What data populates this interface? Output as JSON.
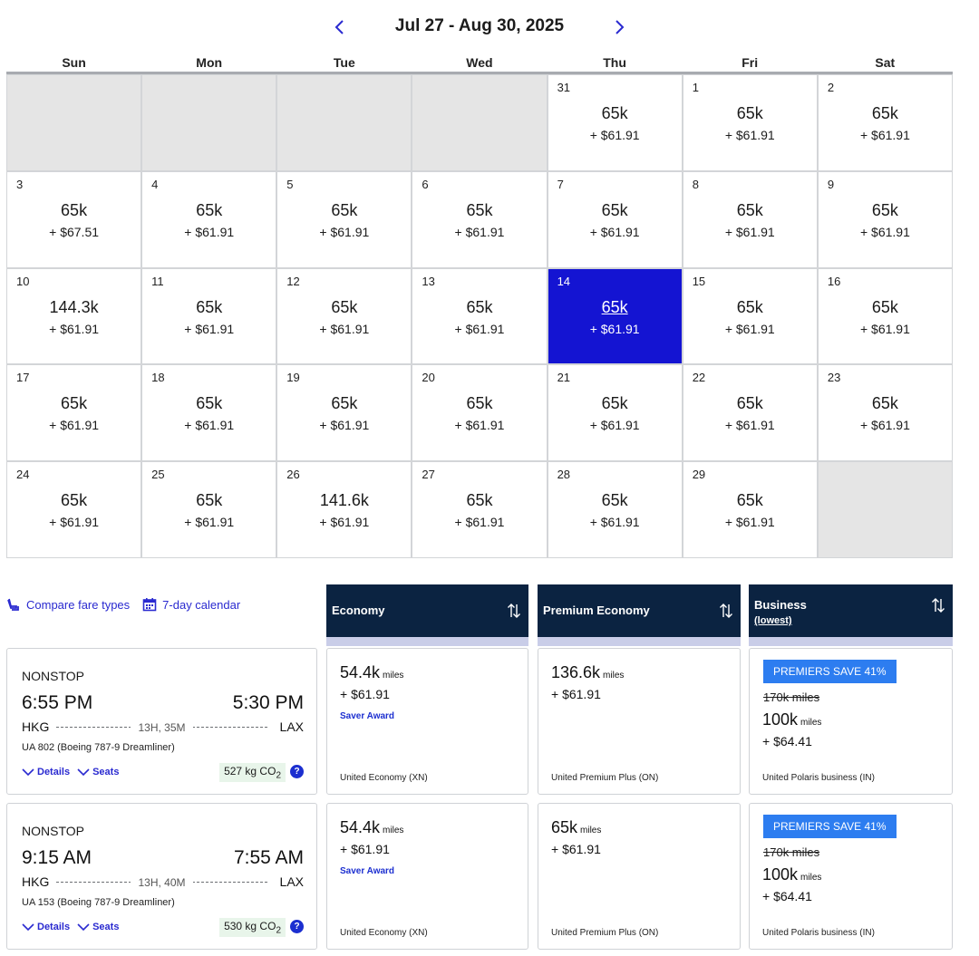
{
  "calendar": {
    "range": "Jul 27 - Aug 30, 2025",
    "weekdays": [
      "Sun",
      "Mon",
      "Tue",
      "Wed",
      "Thu",
      "Fri",
      "Sat"
    ],
    "days": [
      null,
      null,
      null,
      null,
      {
        "d": "31",
        "m": "65k",
        "f": "+ $61.91"
      },
      {
        "d": "1",
        "m": "65k",
        "f": "+ $61.91"
      },
      {
        "d": "2",
        "m": "65k",
        "f": "+ $61.91"
      },
      {
        "d": "3",
        "m": "65k",
        "f": "+ $67.51"
      },
      {
        "d": "4",
        "m": "65k",
        "f": "+ $61.91"
      },
      {
        "d": "5",
        "m": "65k",
        "f": "+ $61.91"
      },
      {
        "d": "6",
        "m": "65k",
        "f": "+ $61.91"
      },
      {
        "d": "7",
        "m": "65k",
        "f": "+ $61.91"
      },
      {
        "d": "8",
        "m": "65k",
        "f": "+ $61.91"
      },
      {
        "d": "9",
        "m": "65k",
        "f": "+ $61.91"
      },
      {
        "d": "10",
        "m": "144.3k",
        "f": "+ $61.91"
      },
      {
        "d": "11",
        "m": "65k",
        "f": "+ $61.91"
      },
      {
        "d": "12",
        "m": "65k",
        "f": "+ $61.91"
      },
      {
        "d": "13",
        "m": "65k",
        "f": "+ $61.91"
      },
      {
        "d": "14",
        "m": "65k",
        "f": "+ $61.91",
        "selected": true
      },
      {
        "d": "15",
        "m": "65k",
        "f": "+ $61.91"
      },
      {
        "d": "16",
        "m": "65k",
        "f": "+ $61.91"
      },
      {
        "d": "17",
        "m": "65k",
        "f": "+ $61.91"
      },
      {
        "d": "18",
        "m": "65k",
        "f": "+ $61.91"
      },
      {
        "d": "19",
        "m": "65k",
        "f": "+ $61.91"
      },
      {
        "d": "20",
        "m": "65k",
        "f": "+ $61.91"
      },
      {
        "d": "21",
        "m": "65k",
        "f": "+ $61.91"
      },
      {
        "d": "22",
        "m": "65k",
        "f": "+ $61.91"
      },
      {
        "d": "23",
        "m": "65k",
        "f": "+ $61.91"
      },
      {
        "d": "24",
        "m": "65k",
        "f": "+ $61.91"
      },
      {
        "d": "25",
        "m": "65k",
        "f": "+ $61.91"
      },
      {
        "d": "26",
        "m": "141.6k",
        "f": "+ $61.91"
      },
      {
        "d": "27",
        "m": "65k",
        "f": "+ $61.91"
      },
      {
        "d": "28",
        "m": "65k",
        "f": "+ $61.91"
      },
      {
        "d": "29",
        "m": "65k",
        "f": "+ $61.91"
      },
      null
    ]
  },
  "tools": {
    "compare": "Compare fare types",
    "seven_day": "7-day calendar"
  },
  "columns": {
    "economy": "Economy",
    "premium": "Premium Economy",
    "business": "Business",
    "business_sub": "(lowest)"
  },
  "flights": [
    {
      "stops": "NONSTOP",
      "dep": "6:55 PM",
      "arr": "5:30 PM",
      "origin": "HKG",
      "dest": "LAX",
      "duration": "13H, 35M",
      "equipment": "UA 802 (Boeing 787-9 Dreamliner)",
      "details": "Details",
      "seats": "Seats",
      "co2": "527 kg CO",
      "co2_sub": "2",
      "info": "?",
      "economy": {
        "miles": "54.4k",
        "unit": "miles",
        "fee": "+ $61.91",
        "saver": "Saver Award",
        "cabin": "United Economy (XN)"
      },
      "premium": {
        "miles": "136.6k",
        "unit": "miles",
        "fee": "+ $61.91",
        "cabin": "United Premium Plus (ON)"
      },
      "business": {
        "badge": "PREMIERS SAVE 41%",
        "strike": "170k miles",
        "miles": "100k",
        "unit": "miles",
        "fee": "+ $64.41",
        "cabin": "United Polaris business (IN)"
      }
    },
    {
      "stops": "NONSTOP",
      "dep": "9:15 AM",
      "arr": "7:55 AM",
      "origin": "HKG",
      "dest": "LAX",
      "duration": "13H, 40M",
      "equipment": "UA 153 (Boeing 787-9 Dreamliner)",
      "details": "Details",
      "seats": "Seats",
      "co2": "530 kg CO",
      "co2_sub": "2",
      "info": "?",
      "economy": {
        "miles": "54.4k",
        "unit": "miles",
        "fee": "+ $61.91",
        "saver": "Saver Award",
        "cabin": "United Economy (XN)"
      },
      "premium": {
        "miles": "65k",
        "unit": "miles",
        "fee": "+ $61.91",
        "cabin": "United Premium Plus (ON)"
      },
      "business": {
        "badge": "PREMIERS SAVE 41%",
        "strike": "170k miles",
        "miles": "100k",
        "unit": "miles",
        "fee": "+ $64.41",
        "cabin": "United Polaris business (IN)"
      }
    }
  ]
}
